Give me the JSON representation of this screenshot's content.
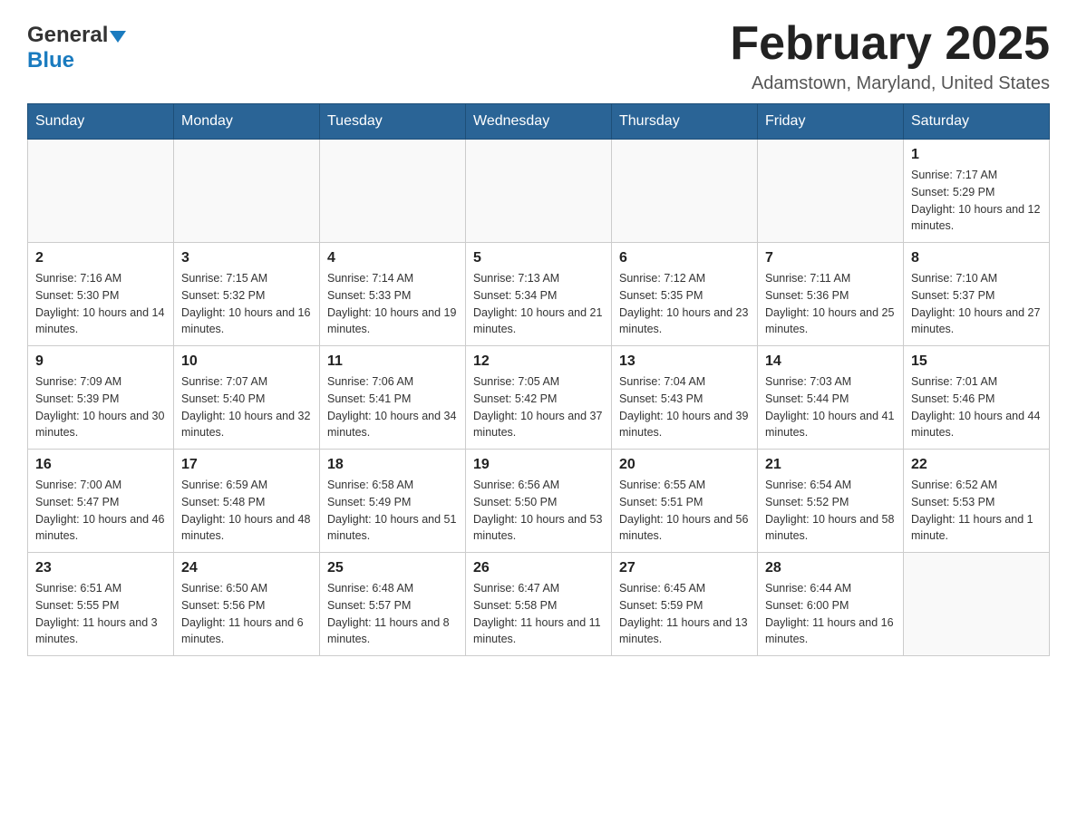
{
  "header": {
    "logo": {
      "general": "General",
      "arrow": "▲",
      "blue": "Blue"
    },
    "title": "February 2025",
    "location": "Adamstown, Maryland, United States"
  },
  "weekdays": [
    "Sunday",
    "Monday",
    "Tuesday",
    "Wednesday",
    "Thursday",
    "Friday",
    "Saturday"
  ],
  "weeks": [
    [
      {
        "day": "",
        "info": ""
      },
      {
        "day": "",
        "info": ""
      },
      {
        "day": "",
        "info": ""
      },
      {
        "day": "",
        "info": ""
      },
      {
        "day": "",
        "info": ""
      },
      {
        "day": "",
        "info": ""
      },
      {
        "day": "1",
        "info": "Sunrise: 7:17 AM\nSunset: 5:29 PM\nDaylight: 10 hours and 12 minutes."
      }
    ],
    [
      {
        "day": "2",
        "info": "Sunrise: 7:16 AM\nSunset: 5:30 PM\nDaylight: 10 hours and 14 minutes."
      },
      {
        "day": "3",
        "info": "Sunrise: 7:15 AM\nSunset: 5:32 PM\nDaylight: 10 hours and 16 minutes."
      },
      {
        "day": "4",
        "info": "Sunrise: 7:14 AM\nSunset: 5:33 PM\nDaylight: 10 hours and 19 minutes."
      },
      {
        "day": "5",
        "info": "Sunrise: 7:13 AM\nSunset: 5:34 PM\nDaylight: 10 hours and 21 minutes."
      },
      {
        "day": "6",
        "info": "Sunrise: 7:12 AM\nSunset: 5:35 PM\nDaylight: 10 hours and 23 minutes."
      },
      {
        "day": "7",
        "info": "Sunrise: 7:11 AM\nSunset: 5:36 PM\nDaylight: 10 hours and 25 minutes."
      },
      {
        "day": "8",
        "info": "Sunrise: 7:10 AM\nSunset: 5:37 PM\nDaylight: 10 hours and 27 minutes."
      }
    ],
    [
      {
        "day": "9",
        "info": "Sunrise: 7:09 AM\nSunset: 5:39 PM\nDaylight: 10 hours and 30 minutes."
      },
      {
        "day": "10",
        "info": "Sunrise: 7:07 AM\nSunset: 5:40 PM\nDaylight: 10 hours and 32 minutes."
      },
      {
        "day": "11",
        "info": "Sunrise: 7:06 AM\nSunset: 5:41 PM\nDaylight: 10 hours and 34 minutes."
      },
      {
        "day": "12",
        "info": "Sunrise: 7:05 AM\nSunset: 5:42 PM\nDaylight: 10 hours and 37 minutes."
      },
      {
        "day": "13",
        "info": "Sunrise: 7:04 AM\nSunset: 5:43 PM\nDaylight: 10 hours and 39 minutes."
      },
      {
        "day": "14",
        "info": "Sunrise: 7:03 AM\nSunset: 5:44 PM\nDaylight: 10 hours and 41 minutes."
      },
      {
        "day": "15",
        "info": "Sunrise: 7:01 AM\nSunset: 5:46 PM\nDaylight: 10 hours and 44 minutes."
      }
    ],
    [
      {
        "day": "16",
        "info": "Sunrise: 7:00 AM\nSunset: 5:47 PM\nDaylight: 10 hours and 46 minutes."
      },
      {
        "day": "17",
        "info": "Sunrise: 6:59 AM\nSunset: 5:48 PM\nDaylight: 10 hours and 48 minutes."
      },
      {
        "day": "18",
        "info": "Sunrise: 6:58 AM\nSunset: 5:49 PM\nDaylight: 10 hours and 51 minutes."
      },
      {
        "day": "19",
        "info": "Sunrise: 6:56 AM\nSunset: 5:50 PM\nDaylight: 10 hours and 53 minutes."
      },
      {
        "day": "20",
        "info": "Sunrise: 6:55 AM\nSunset: 5:51 PM\nDaylight: 10 hours and 56 minutes."
      },
      {
        "day": "21",
        "info": "Sunrise: 6:54 AM\nSunset: 5:52 PM\nDaylight: 10 hours and 58 minutes."
      },
      {
        "day": "22",
        "info": "Sunrise: 6:52 AM\nSunset: 5:53 PM\nDaylight: 11 hours and 1 minute."
      }
    ],
    [
      {
        "day": "23",
        "info": "Sunrise: 6:51 AM\nSunset: 5:55 PM\nDaylight: 11 hours and 3 minutes."
      },
      {
        "day": "24",
        "info": "Sunrise: 6:50 AM\nSunset: 5:56 PM\nDaylight: 11 hours and 6 minutes."
      },
      {
        "day": "25",
        "info": "Sunrise: 6:48 AM\nSunset: 5:57 PM\nDaylight: 11 hours and 8 minutes."
      },
      {
        "day": "26",
        "info": "Sunrise: 6:47 AM\nSunset: 5:58 PM\nDaylight: 11 hours and 11 minutes."
      },
      {
        "day": "27",
        "info": "Sunrise: 6:45 AM\nSunset: 5:59 PM\nDaylight: 11 hours and 13 minutes."
      },
      {
        "day": "28",
        "info": "Sunrise: 6:44 AM\nSunset: 6:00 PM\nDaylight: 11 hours and 16 minutes."
      },
      {
        "day": "",
        "info": ""
      }
    ]
  ]
}
